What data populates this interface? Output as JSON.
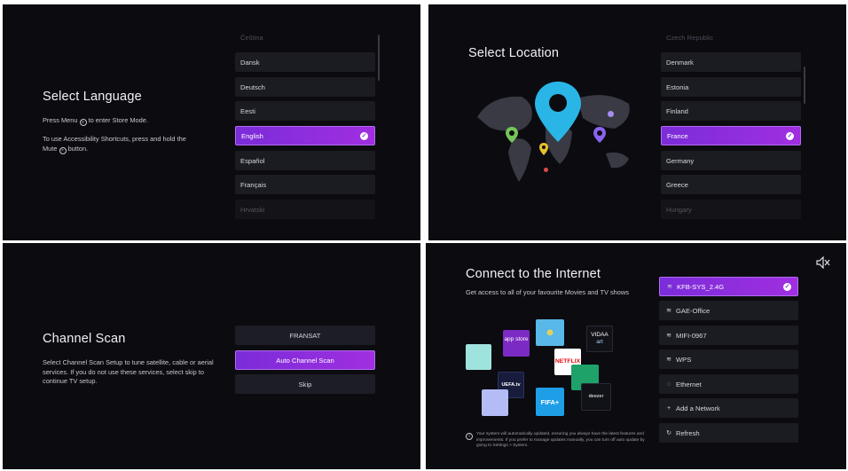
{
  "language": {
    "title": "Select Language",
    "line1_pre": "Press Menu",
    "line1_post": "to enter Store Mode.",
    "line2_pre": "To use Accessibility Shortcuts, press and hold the",
    "line2_mute": "Mute",
    "line2_post": "button.",
    "items": [
      "Čeština",
      "Dansk",
      "Deutsch",
      "Eesti",
      "English",
      "Español",
      "Français",
      "Hrvatski"
    ],
    "selected": "English"
  },
  "location": {
    "title": "Select Location",
    "items": [
      "Czech Republic",
      "Denmark",
      "Estonia",
      "Finland",
      "France",
      "Germany",
      "Greece",
      "Hungary"
    ],
    "selected": "France"
  },
  "channel_scan": {
    "title": "Channel Scan",
    "description": "Select Channel Scan Setup to tune satellite, cable or aerial services. If you do not use these services, select skip to continue TV setup.",
    "buttons": [
      "FRANSAT",
      "Auto Channel Scan",
      "Skip"
    ],
    "selected": "Auto Channel Scan"
  },
  "internet": {
    "title": "Connect to the Internet",
    "subtitle": "Get access to all of your favourite Movies and TV shows",
    "footnote": "Your system will automatically updated, ensuring you always have the latest features and improvements. If you prefer to manage updates manually, you can turn off auto update by going to Settings > System.",
    "apps": {
      "appstore": "app store",
      "vidaa": "VIDAA",
      "vidaa_sub": "art",
      "netflix": "NETFLIX",
      "uefa": "UEFA.tv",
      "fifa": "FIFA+",
      "deezer": "deezer"
    },
    "networks": [
      {
        "icon": "wifi-icon",
        "glyph": "≋",
        "label": "KFB-SYS_2.4G"
      },
      {
        "icon": "wifi-icon",
        "glyph": "≋",
        "label": "GAE-Office"
      },
      {
        "icon": "wifi-icon",
        "glyph": "≋",
        "label": "MIFI-0967"
      },
      {
        "icon": "wps-icon",
        "glyph": "≋",
        "label": "WPS"
      },
      {
        "icon": "ethernet-icon",
        "glyph": "◌",
        "label": "Ethernet"
      },
      {
        "icon": "plus-icon",
        "glyph": "+",
        "label": "Add a Network"
      },
      {
        "icon": "refresh-icon",
        "glyph": "↻",
        "label": "Refresh"
      }
    ],
    "selected": "KFB-SYS_2.4G",
    "mute_icon": "speaker-muted-icon"
  },
  "colors": {
    "accent": "#8b2fdf",
    "background": "#0b0b10",
    "item": "#1b1b22"
  }
}
